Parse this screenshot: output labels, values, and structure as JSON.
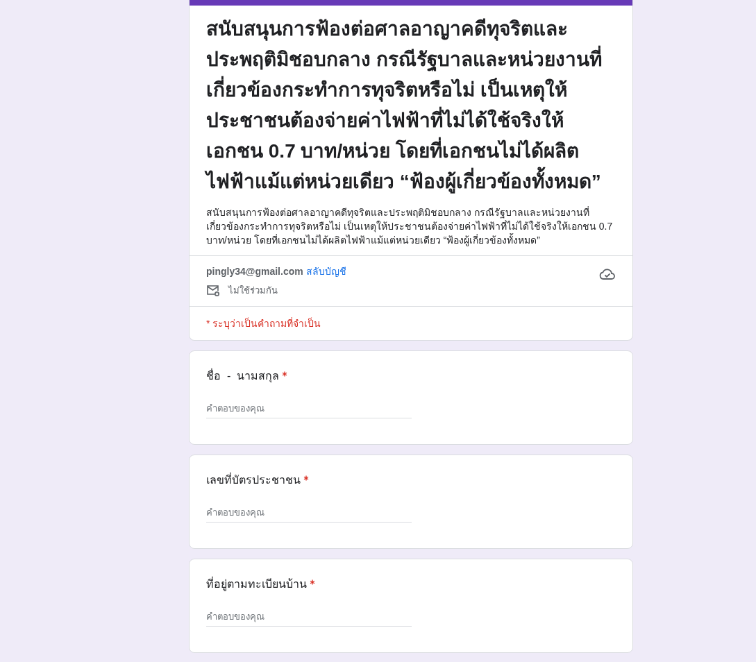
{
  "form": {
    "title": "สนับสนุนการฟ้องต่อศาลอาญาคดีทุจริตและประพฤติมิชอบกลาง กรณีรัฐบาลและหน่วยงานที่เกี่ยวข้องกระทำการทุจริตหรือไม่ เป็นเหตุให้ประชาชนต้องจ่ายค่าไฟฟ้าที่ไม่ได้ใช้จริงให้เอกชน 0.7 บาท/หน่วย โดยที่เอกชนไม่ได้ผลิตไฟฟ้าแม้แต่หน่วยเดียว “ฟ้องผู้เกี่ยวข้องทั้งหมด”",
    "description": "สนับสนุนการฟ้องต่อศาลอาญาคดีทุจริตและประพฤติมิชอบกลาง กรณีรัฐบาลและหน่วยงานที่เกี่ยวข้องกระทำการทุจริตหรือไม่ เป็นเหตุให้ประชาชนต้องจ่ายค่าไฟฟ้าที่ไม่ได้ใช้จริงให้เอกชน 0.7 บาท/หน่วย โดยที่เอกชนไม่ได้ผลิตไฟฟ้าแม้แต่หน่วยเดียว “ฟ้องผู้เกี่ยวข้องทั้งหมด”",
    "account": {
      "email": "pingly34@gmail.com",
      "switch_link": "สลับบัญชี",
      "sharing_note": "ไม่ใช้ร่วมกัน"
    },
    "required_note": "* ระบุว่าเป็นคำถามที่จำเป็น"
  },
  "questions": [
    {
      "label": "ชื่อ  -  นามสกุล",
      "required": true,
      "placeholder": "คำตอบของคุณ"
    },
    {
      "label": "เลขที่บัตรประชาชน",
      "required": true,
      "placeholder": "คำตอบของคุณ"
    },
    {
      "label": "ที่อยู่ตามทะเบียนบ้าน",
      "required": true,
      "placeholder": "คำตอบของคุณ"
    }
  ]
}
